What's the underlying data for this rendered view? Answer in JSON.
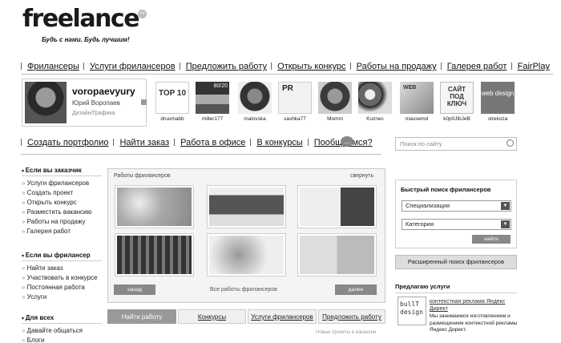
{
  "logo": {
    "text": "freelance",
    "badge": "ru",
    "slogan": "Будь с нами. Будь лучшим!"
  },
  "nav": [
    "Фрилансеры",
    "Услуги фрилансеров",
    "Предложить работу",
    "Открыть конкурс",
    "Работы на продажу",
    "Галерея работ",
    "FairPlay"
  ],
  "profile": {
    "username": "voropaevyury",
    "realname": "Юрий Воропаев",
    "spec": "Дизайн/Графика"
  },
  "freelancers": [
    "druumabb",
    "miller177",
    "malovska",
    "sashka77",
    "Momm",
    "Kuznec",
    "mausemd",
    "k0p0JlbJeB",
    "strekoza"
  ],
  "thumb_text": {
    "druumabb": "TOP 10",
    "miller177": "80/20",
    "sashka77": "PR",
    "mausemd": "WEB",
    "k0p0JlbJeB": "САЙТ ПОД КЛЮЧ",
    "strekoza": "web design"
  },
  "nav2": [
    "Создать портфолио",
    "Найти заказ",
    "Работа в офисе",
    "В конкурсы",
    "Пообщаемся?"
  ],
  "bubble": "...",
  "search": {
    "placeholder": "Поиск по сайту"
  },
  "sidebar": {
    "employer": {
      "title": "Если вы заказчик",
      "items": [
        "Услуги фрилансеров",
        "Создать проект",
        "Открыть конкурс",
        "Разместить вакансию",
        "Работы на продажу",
        "Галерея работ"
      ]
    },
    "freelancer": {
      "title": "Если вы фрилансер",
      "items": [
        "Найти заказ",
        "Участвовать в конкурсе",
        "Постоянная работа",
        "Услуги"
      ]
    },
    "all": {
      "title": "Для всех",
      "items": [
        "Давайте общаться",
        "Блоги"
      ]
    }
  },
  "works": {
    "title": "Работы фрилансеров",
    "collapse": "свернуть",
    "back": "назад",
    "all": "Все работы фрилансеров",
    "next": "далее"
  },
  "tabs": [
    "Найти работу",
    "Конкурсы",
    "Услуги фрилансеров",
    "Предложить работу"
  ],
  "new_projects": "Новые проекты в вакансии",
  "quick_search": {
    "title": "Быстрый поиск фрилансеров",
    "spec": "Специализация",
    "category": "Категория",
    "find": "найти"
  },
  "advanced_search": "Расширенный поиск фрилансеров",
  "offer": {
    "title": "Предлагаю услуги",
    "logo_text": "bullT design",
    "link": "контекстная реклама Яндекс Директ",
    "desc": "Мы занимаемся изготовлением и размещением контекстной рекламы Яндекс Директ."
  }
}
